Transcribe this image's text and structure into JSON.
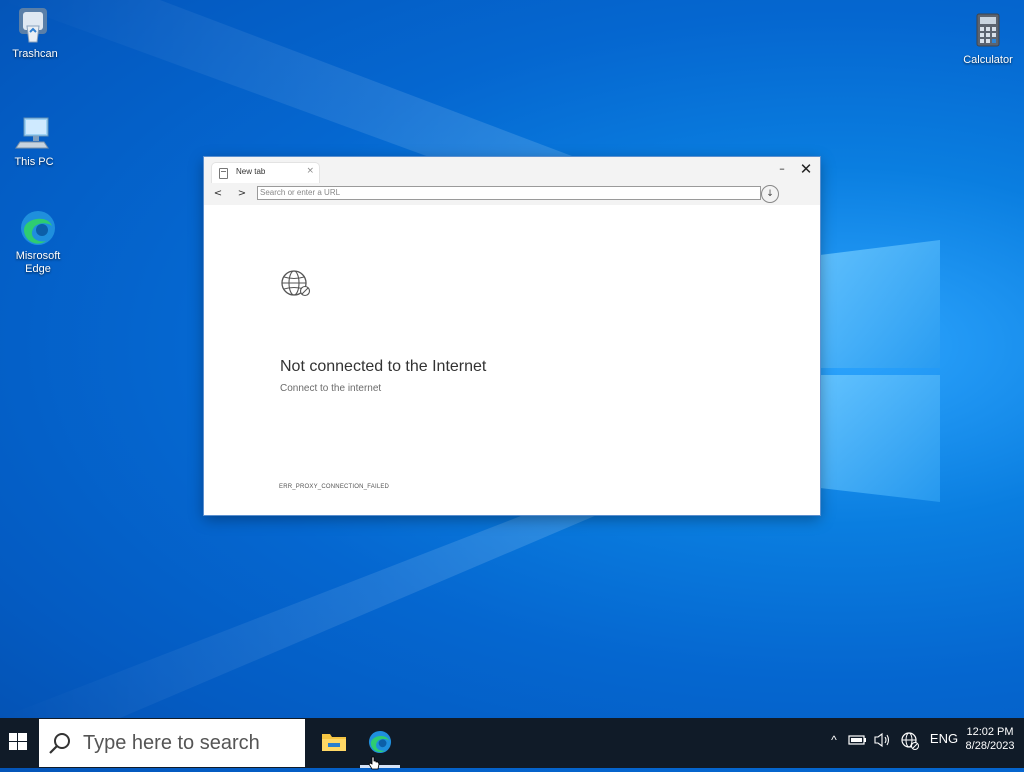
{
  "desktop": {
    "icons": [
      {
        "label": "Trashcan",
        "icon": "recycle-bin-icon"
      },
      {
        "label": "This PC",
        "icon": "computer-icon"
      },
      {
        "label": "Misrosoft Edge",
        "icon": "edge-icon"
      },
      {
        "label": "Calculator",
        "icon": "calculator-icon"
      }
    ]
  },
  "browser": {
    "tab_label": "New tab",
    "tab_close": "×",
    "minimize": "–",
    "close": "✕",
    "back": "<",
    "forward": ">",
    "url_placeholder": "Search or enter a URL",
    "download_glyph": "↓",
    "error_title": "Not connected to the Internet",
    "error_subtitle": "Connect to the internet",
    "error_code": "ERR_PROXY_CONNECTION_FAILED"
  },
  "taskbar": {
    "search_placeholder": "Type here to search",
    "apps": [
      {
        "name": "File Explorer",
        "icon": "folder-icon",
        "active": false
      },
      {
        "name": "Microsoft Edge",
        "icon": "edge-icon",
        "active": true
      }
    ],
    "tray": {
      "chevron": "^",
      "language": "ENG",
      "time": "12:02 PM",
      "date": "8/28/2023"
    }
  },
  "colors": {
    "accent": "#0078d7",
    "taskbar": "#101b28",
    "wallpaper": "#0567d0"
  }
}
